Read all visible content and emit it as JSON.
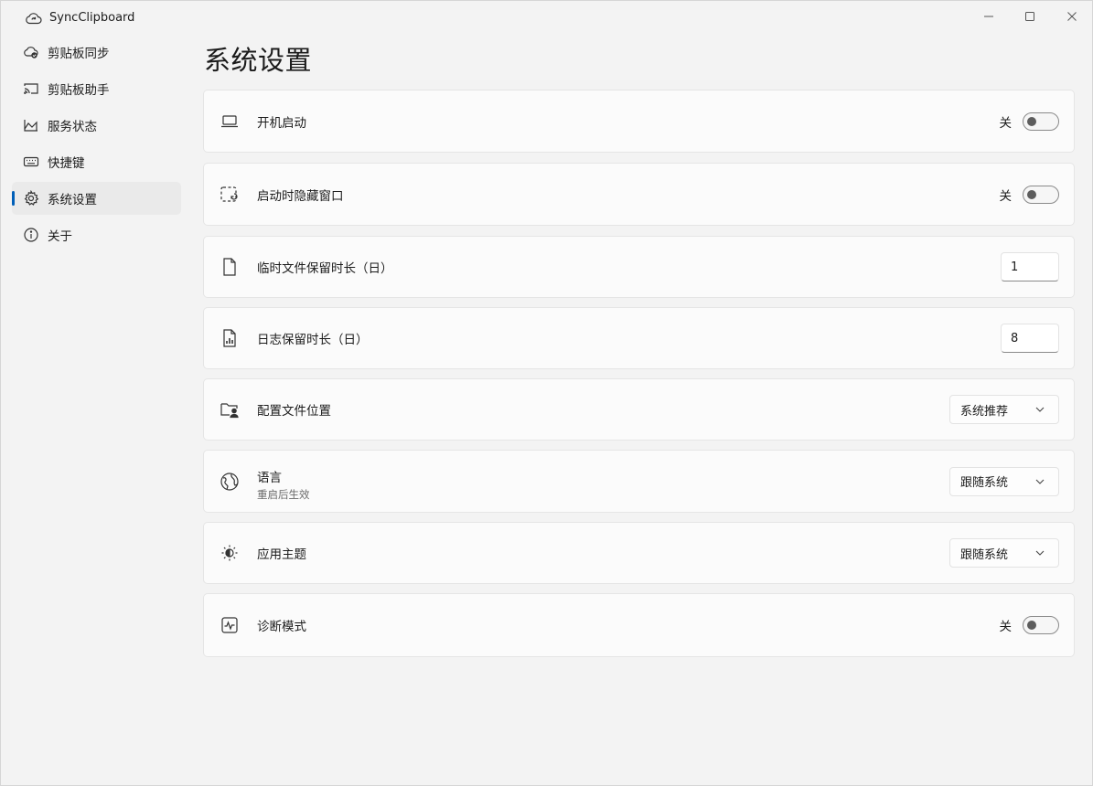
{
  "app": {
    "title": "SyncClipboard",
    "window_controls": [
      "minimize-icon",
      "maximize-icon",
      "close-icon"
    ]
  },
  "nav": {
    "items": [
      {
        "label": "剪贴板同步",
        "icon": "cloud-sync-icon",
        "active": false
      },
      {
        "label": "剪贴板助手",
        "icon": "cast-icon",
        "active": false
      },
      {
        "label": "服务状态",
        "icon": "area-chart-icon",
        "active": false
      },
      {
        "label": "快捷键",
        "icon": "keyboard-icon",
        "active": false
      },
      {
        "label": "系统设置",
        "icon": "gear-icon",
        "active": true
      },
      {
        "label": "关于",
        "icon": "info-icon",
        "active": false
      }
    ]
  },
  "page": {
    "title": "系统设置"
  },
  "settings": {
    "startup": {
      "label": "开机启动",
      "state": "关",
      "icon": "laptop-icon"
    },
    "hide_window": {
      "label": "启动时隐藏窗口",
      "state": "关",
      "icon": "dashed-window-icon"
    },
    "temp_files": {
      "label": "临时文件保留时长（日）",
      "value": "1",
      "icon": "document-icon"
    },
    "log_retention": {
      "label": "日志保留时长（日）",
      "value": "8",
      "icon": "log-chart-icon"
    },
    "config_location": {
      "label": "配置文件位置",
      "value": "系统推荐",
      "icon": "folder-person-icon"
    },
    "language": {
      "label": "语言",
      "sub": "重启后生效",
      "value": "跟随系统",
      "icon": "globe-icon"
    },
    "theme": {
      "label": "应用主题",
      "value": "跟随系统",
      "icon": "brightness-icon"
    },
    "diagnostic": {
      "label": "诊断模式",
      "state": "关",
      "icon": "pulse-icon"
    }
  },
  "colors": {
    "accent": "#005fb8",
    "background": "#f3f3f3",
    "card": "#fbfbfb"
  }
}
